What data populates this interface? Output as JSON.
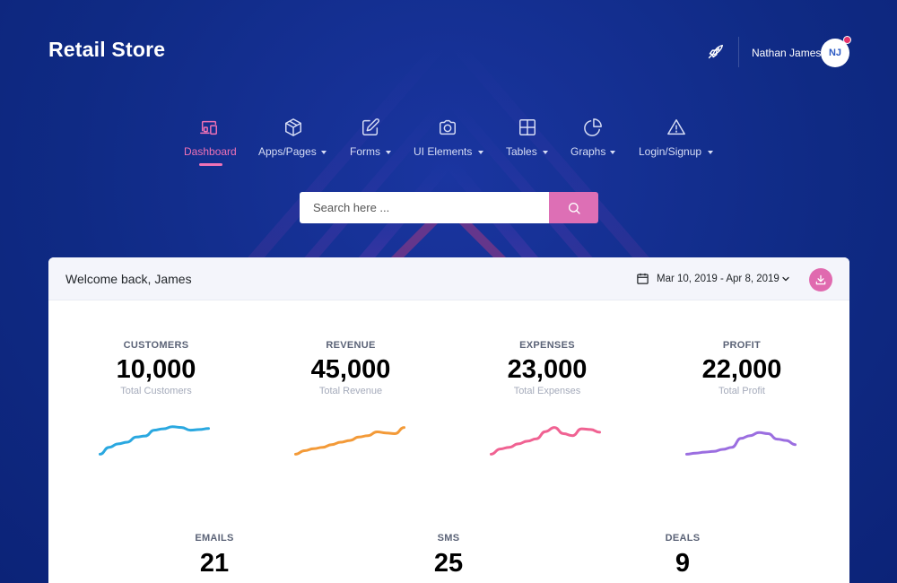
{
  "app": {
    "brand": "Retail Store"
  },
  "user": {
    "name": "Nathan James",
    "initials": "NJ"
  },
  "nav": {
    "items": [
      {
        "label": "Dashboard",
        "icon": "devices-icon",
        "active": true,
        "dropdown": false
      },
      {
        "label": "Apps/Pages",
        "icon": "box-icon",
        "active": false,
        "dropdown": true
      },
      {
        "label": "Forms",
        "icon": "edit-icon",
        "active": false,
        "dropdown": true
      },
      {
        "label": "UI Elements",
        "icon": "camera-icon",
        "active": false,
        "dropdown": true
      },
      {
        "label": "Tables",
        "icon": "grid-icon",
        "active": false,
        "dropdown": true
      },
      {
        "label": "Graphs",
        "icon": "pie-chart-icon",
        "active": false,
        "dropdown": true
      },
      {
        "label": "Login/Signup",
        "icon": "alert-triangle-icon",
        "active": false,
        "dropdown": true
      }
    ]
  },
  "search": {
    "placeholder": "Search here ..."
  },
  "card": {
    "welcome": "Welcome back, James",
    "date_range": "Mar 10, 2019 - Apr 8, 2019"
  },
  "stats": [
    {
      "label": "CUSTOMERS",
      "value": "10,000",
      "sub": "Total Customers",
      "color": "#2aa8e0"
    },
    {
      "label": "REVENUE",
      "value": "45,000",
      "sub": "Total Revenue",
      "color": "#f39a38"
    },
    {
      "label": "EXPENSES",
      "value": "23,000",
      "sub": "Total Expenses",
      "color": "#f06292"
    },
    {
      "label": "PROFIT",
      "value": "22,000",
      "sub": "Total Profit",
      "color": "#9b6ee0"
    }
  ],
  "mini_stats": [
    {
      "label": "EMAILS",
      "value": "21"
    },
    {
      "label": "SMS",
      "value": "25"
    },
    {
      "label": "DEALS",
      "value": "9"
    }
  ],
  "colors": {
    "background": "#0f2a84",
    "accent_pink": "#f072b6",
    "search_button": "#dd6fb5",
    "notification_dot": "#e6336b"
  },
  "chart_data": [
    {
      "type": "line",
      "series": [
        {
          "values": [
            2,
            4,
            5,
            5.5,
            7,
            7.3,
            9,
            9.4,
            10,
            9.8,
            9,
            9.2,
            9.5
          ]
        }
      ]
    },
    {
      "type": "line",
      "series": [
        {
          "values": [
            2,
            3,
            3.6,
            4,
            4.8,
            5.5,
            6,
            7,
            7.4,
            8.5,
            8.2,
            8,
            9.8
          ]
        }
      ]
    },
    {
      "type": "line",
      "series": [
        {
          "values": [
            2,
            3.5,
            4,
            5,
            5.8,
            6.5,
            8.6,
            9.8,
            8,
            7.4,
            9.4,
            9.2,
            8.4
          ]
        }
      ]
    },
    {
      "type": "line",
      "series": [
        {
          "values": [
            2,
            2.3,
            2.6,
            2.8,
            3.4,
            4,
            6.6,
            7.4,
            8.3,
            8,
            6.4,
            6,
            4.8
          ]
        }
      ]
    }
  ]
}
